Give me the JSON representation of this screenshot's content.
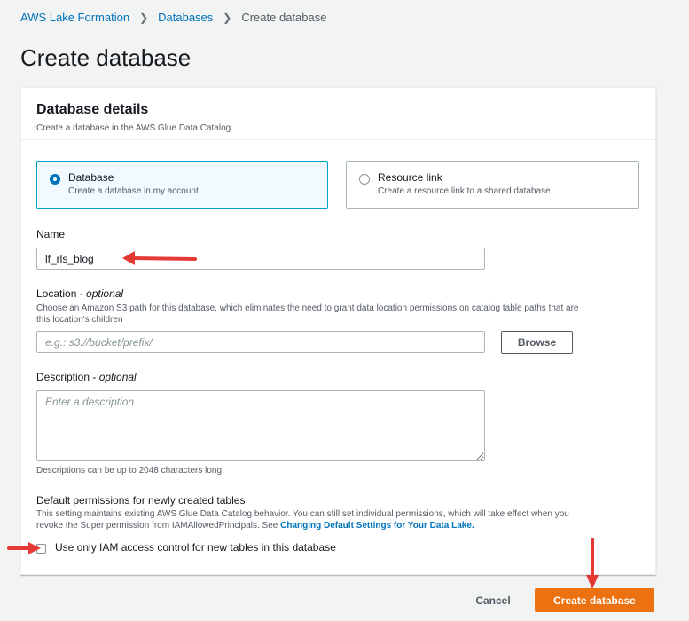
{
  "breadcrumb": {
    "items": [
      "AWS Lake Formation",
      "Databases",
      "Create database"
    ]
  },
  "page_title": "Create database",
  "panel": {
    "title": "Database details",
    "subtitle": "Create a database in the AWS Glue Data Catalog."
  },
  "tiles": [
    {
      "label": "Database",
      "description": "Create a database in my account.",
      "selected": true
    },
    {
      "label": "Resource link",
      "description": "Create a resource link to a shared database.",
      "selected": false
    }
  ],
  "name_field": {
    "label": "Name",
    "value": "lf_rls_blog"
  },
  "location_field": {
    "label": "Location - ",
    "optional": "optional",
    "hint_line1": "Choose an Amazon S3 path for this database, which eliminates the need to grant data location permissions on catalog table paths that are",
    "hint_line2": "this location's children",
    "placeholder": "e.g.: s3://bucket/prefix/",
    "browse_label": "Browse"
  },
  "description_field": {
    "label": "Description - ",
    "optional": "optional",
    "placeholder": "Enter a description",
    "hint": "Descriptions can be up to 2048 characters long."
  },
  "default_permissions": {
    "title": "Default permissions for newly created tables",
    "desc_line1": "This setting maintains existing AWS Glue Data Catalog behavior. You can still set individual permissions, which will take effect when you",
    "desc_line2": "revoke the Super permission from IAMAllowedPrincipals. See ",
    "link_text": "Changing Default Settings for Your Data Lake.",
    "checkbox_label": "Use only IAM access control for new tables in this database",
    "checked": false
  },
  "footer": {
    "cancel_label": "Cancel",
    "create_label": "Create database"
  },
  "colors": {
    "accent": "#0073bb",
    "primary_button": "#ec7211",
    "annotation_arrow": "#e53935"
  }
}
